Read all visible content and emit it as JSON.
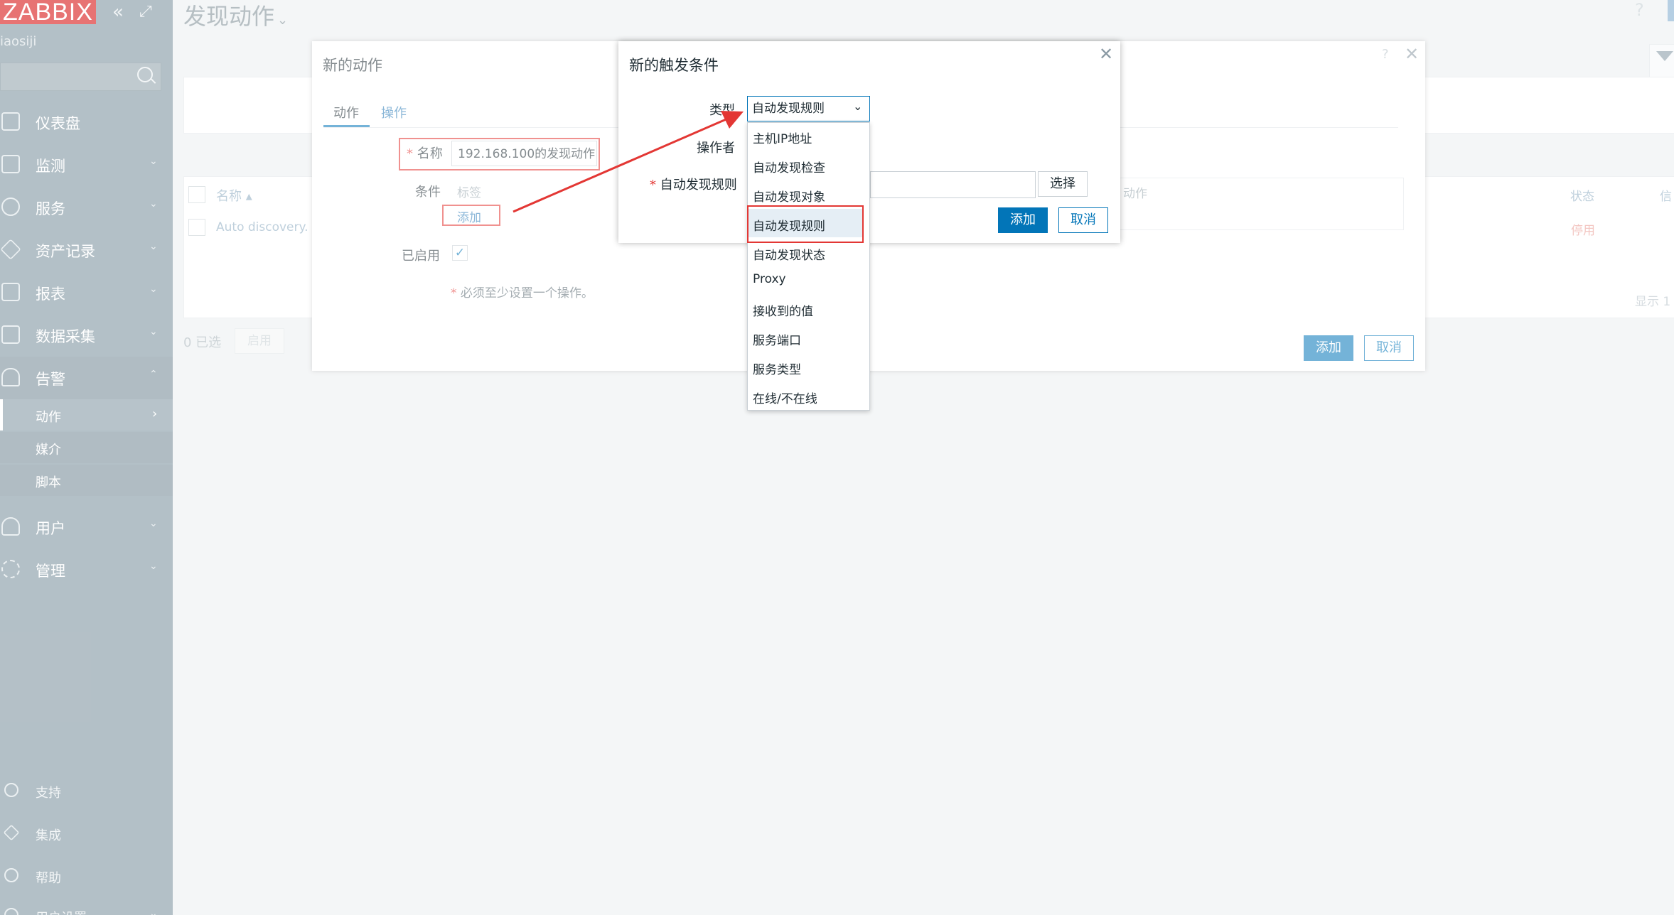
{
  "sidebar": {
    "logo": "ZABBIX",
    "user": "iaosiji",
    "items": [
      {
        "label": "仪表盘",
        "chevron": ""
      },
      {
        "label": "监测",
        "chevron": "⌄"
      },
      {
        "label": "服务",
        "chevron": "⌄"
      },
      {
        "label": "资产记录",
        "chevron": "⌄"
      },
      {
        "label": "报表",
        "chevron": "⌄"
      },
      {
        "label": "数据采集",
        "chevron": "⌄"
      },
      {
        "label": "告警",
        "chevron": "⌃"
      }
    ],
    "alert_sub": [
      {
        "label": "动作",
        "chevron": "›"
      },
      {
        "label": "媒介"
      },
      {
        "label": "脚本"
      }
    ],
    "items_after": [
      {
        "label": "用户",
        "chevron": "⌄"
      },
      {
        "label": "管理",
        "chevron": "⌄"
      }
    ],
    "bottom": [
      {
        "label": "支持"
      },
      {
        "label": "集成"
      },
      {
        "label": "帮助"
      },
      {
        "label": "用户设置",
        "chevron": "⌄"
      }
    ]
  },
  "page": {
    "title": "发现动作",
    "title_dropdown": "⌄",
    "help": "?"
  },
  "background_list": {
    "col_name": "名称 ▴",
    "row_name": "Auto discovery. L",
    "col_status": "状态",
    "col_info": "信",
    "row_status": "停用",
    "footer": "显示 1",
    "selected": "0 已选",
    "enable_button": "启用"
  },
  "action_dialog": {
    "title": "新的动作",
    "help": "?",
    "close": "✕",
    "tabs": [
      "动作",
      "操作"
    ],
    "name_label": "名称",
    "name_value": "192.168.100的发现动作",
    "conditions_label": "条件",
    "conditions_col": "标签",
    "add_link": "添加",
    "enabled_label": "已启用",
    "enabled_check": "✓",
    "note": "必须至少设置一个操作。",
    "ops_col": "动作",
    "add_button": "添加",
    "cancel_button": "取消",
    "required_mark": "*"
  },
  "condition_dialog": {
    "title": "新的触发条件",
    "close": "✕",
    "type_label": "类型",
    "type_value": "自动发现规则",
    "type_arrow": "⌄",
    "operator_label": "操作者",
    "rule_label": "自动发现规则",
    "select_button": "选择",
    "add_button": "添加",
    "cancel_button": "取消",
    "required_mark": "*"
  },
  "dropdown": {
    "options": [
      "主机IP地址",
      "自动发现检查",
      "自动发现对象",
      "自动发现规则",
      "自动发现状态",
      "Proxy",
      "接收到的值",
      "服务端口",
      "服务类型",
      "在线/不在线"
    ],
    "selected_index": 3
  },
  "colors": {
    "sidebar": "#768d99",
    "accent": "#0275b8",
    "highlight": "#e33734",
    "logo": "#d40000"
  }
}
